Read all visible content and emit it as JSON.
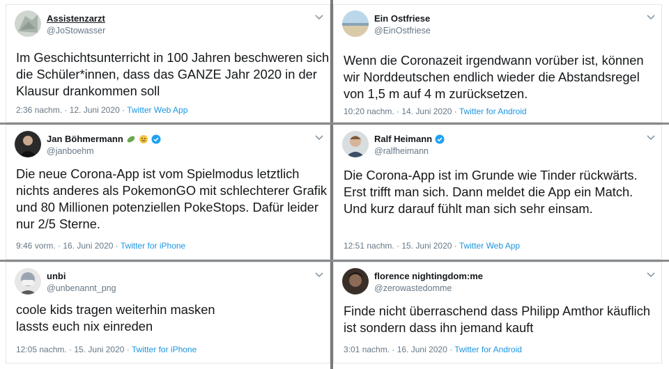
{
  "tweets": [
    {
      "name": "Assistenzarzt",
      "handle": "@JoStowasser",
      "text": "Im Geschichtsunterricht in 100 Jahren beschweren sich\ndie Schüler*innen, dass das GANZE Jahr 2020 in der\nKlausur drankommen soll",
      "time": "2:36 nachm. · 12. Juni 2020 · ",
      "source": "Twitter Web App",
      "verified": false
    },
    {
      "name": "Ein Ostfriese",
      "handle": "@EinOstfriese",
      "text": "Wenn die Coronazeit irgendwann vorüber ist, können\nwir Norddeutschen endlich wieder die Abstandsregel\nvon 1,5 m auf 4 m zurücksetzen.",
      "time": "10:20 nachm. · 14. Juni 2020 · ",
      "source": "Twitter for Android",
      "verified": false
    },
    {
      "name": "Jan Böhmermann",
      "handle": "@janboehm",
      "text": "Die neue Corona-App ist vom Spielmodus letztlich\nnichts anderes als PokemonGO mit schlechterer Grafik\nund 80 Millionen potenziellen PokeStops. Dafür leider\nnur 2/5 Sterne.",
      "time": "9:46 vorm. · 16. Juni 2020 · ",
      "source": "Twitter for iPhone",
      "verified": true
    },
    {
      "name": "Ralf Heimann",
      "handle": "@ralfheimann",
      "text": "Die Corona-App ist im Grunde wie Tinder rückwärts.\nErst trifft man sich. Dann meldet die App ein Match.\nUnd kurz darauf fühlt man sich sehr einsam.",
      "time": "12:51 nachm. · 15. Juni 2020 · ",
      "source": "Twitter Web App",
      "verified": true
    },
    {
      "name": "unbi",
      "handle": "@unbenannt_png",
      "text": "coole kids tragen weiterhin masken\nlassts euch nix einreden",
      "time": "12:05 nachm. · 15. Juni 2020 · ",
      "source": "Twitter for iPhone",
      "verified": false
    },
    {
      "name": "florence nightingdom:me",
      "handle": "@zerowastedomme",
      "text": "Finde nicht überraschend dass Philipp Amthor käuflich\nist sondern dass ihn jemand kauft",
      "time": "3:01 nachm. · 16. Juni 2020 · ",
      "source": "Twitter for Android",
      "verified": false
    }
  ],
  "colors": {
    "link": "#1b95e0",
    "muted": "#657786",
    "verified": "#1da1f2"
  }
}
